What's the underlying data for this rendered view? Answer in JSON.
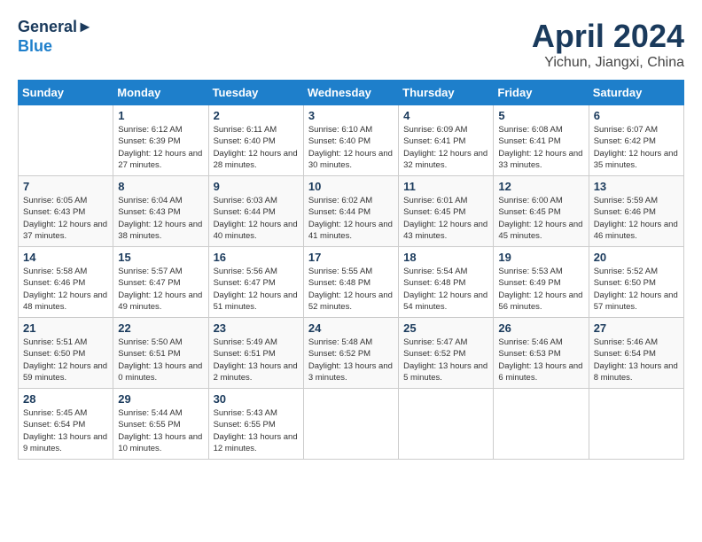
{
  "header": {
    "logo_line1": "General",
    "logo_line2": "Blue",
    "month_title": "April 2024",
    "location": "Yichun, Jiangxi, China"
  },
  "weekdays": [
    "Sunday",
    "Monday",
    "Tuesday",
    "Wednesday",
    "Thursday",
    "Friday",
    "Saturday"
  ],
  "weeks": [
    [
      {
        "num": "",
        "info": ""
      },
      {
        "num": "1",
        "info": "Sunrise: 6:12 AM\nSunset: 6:39 PM\nDaylight: 12 hours\nand 27 minutes."
      },
      {
        "num": "2",
        "info": "Sunrise: 6:11 AM\nSunset: 6:40 PM\nDaylight: 12 hours\nand 28 minutes."
      },
      {
        "num": "3",
        "info": "Sunrise: 6:10 AM\nSunset: 6:40 PM\nDaylight: 12 hours\nand 30 minutes."
      },
      {
        "num": "4",
        "info": "Sunrise: 6:09 AM\nSunset: 6:41 PM\nDaylight: 12 hours\nand 32 minutes."
      },
      {
        "num": "5",
        "info": "Sunrise: 6:08 AM\nSunset: 6:41 PM\nDaylight: 12 hours\nand 33 minutes."
      },
      {
        "num": "6",
        "info": "Sunrise: 6:07 AM\nSunset: 6:42 PM\nDaylight: 12 hours\nand 35 minutes."
      }
    ],
    [
      {
        "num": "7",
        "info": "Sunrise: 6:05 AM\nSunset: 6:43 PM\nDaylight: 12 hours\nand 37 minutes."
      },
      {
        "num": "8",
        "info": "Sunrise: 6:04 AM\nSunset: 6:43 PM\nDaylight: 12 hours\nand 38 minutes."
      },
      {
        "num": "9",
        "info": "Sunrise: 6:03 AM\nSunset: 6:44 PM\nDaylight: 12 hours\nand 40 minutes."
      },
      {
        "num": "10",
        "info": "Sunrise: 6:02 AM\nSunset: 6:44 PM\nDaylight: 12 hours\nand 41 minutes."
      },
      {
        "num": "11",
        "info": "Sunrise: 6:01 AM\nSunset: 6:45 PM\nDaylight: 12 hours\nand 43 minutes."
      },
      {
        "num": "12",
        "info": "Sunrise: 6:00 AM\nSunset: 6:45 PM\nDaylight: 12 hours\nand 45 minutes."
      },
      {
        "num": "13",
        "info": "Sunrise: 5:59 AM\nSunset: 6:46 PM\nDaylight: 12 hours\nand 46 minutes."
      }
    ],
    [
      {
        "num": "14",
        "info": "Sunrise: 5:58 AM\nSunset: 6:46 PM\nDaylight: 12 hours\nand 48 minutes."
      },
      {
        "num": "15",
        "info": "Sunrise: 5:57 AM\nSunset: 6:47 PM\nDaylight: 12 hours\nand 49 minutes."
      },
      {
        "num": "16",
        "info": "Sunrise: 5:56 AM\nSunset: 6:47 PM\nDaylight: 12 hours\nand 51 minutes."
      },
      {
        "num": "17",
        "info": "Sunrise: 5:55 AM\nSunset: 6:48 PM\nDaylight: 12 hours\nand 52 minutes."
      },
      {
        "num": "18",
        "info": "Sunrise: 5:54 AM\nSunset: 6:48 PM\nDaylight: 12 hours\nand 54 minutes."
      },
      {
        "num": "19",
        "info": "Sunrise: 5:53 AM\nSunset: 6:49 PM\nDaylight: 12 hours\nand 56 minutes."
      },
      {
        "num": "20",
        "info": "Sunrise: 5:52 AM\nSunset: 6:50 PM\nDaylight: 12 hours\nand 57 minutes."
      }
    ],
    [
      {
        "num": "21",
        "info": "Sunrise: 5:51 AM\nSunset: 6:50 PM\nDaylight: 12 hours\nand 59 minutes."
      },
      {
        "num": "22",
        "info": "Sunrise: 5:50 AM\nSunset: 6:51 PM\nDaylight: 13 hours\nand 0 minutes."
      },
      {
        "num": "23",
        "info": "Sunrise: 5:49 AM\nSunset: 6:51 PM\nDaylight: 13 hours\nand 2 minutes."
      },
      {
        "num": "24",
        "info": "Sunrise: 5:48 AM\nSunset: 6:52 PM\nDaylight: 13 hours\nand 3 minutes."
      },
      {
        "num": "25",
        "info": "Sunrise: 5:47 AM\nSunset: 6:52 PM\nDaylight: 13 hours\nand 5 minutes."
      },
      {
        "num": "26",
        "info": "Sunrise: 5:46 AM\nSunset: 6:53 PM\nDaylight: 13 hours\nand 6 minutes."
      },
      {
        "num": "27",
        "info": "Sunrise: 5:46 AM\nSunset: 6:54 PM\nDaylight: 13 hours\nand 8 minutes."
      }
    ],
    [
      {
        "num": "28",
        "info": "Sunrise: 5:45 AM\nSunset: 6:54 PM\nDaylight: 13 hours\nand 9 minutes."
      },
      {
        "num": "29",
        "info": "Sunrise: 5:44 AM\nSunset: 6:55 PM\nDaylight: 13 hours\nand 10 minutes."
      },
      {
        "num": "30",
        "info": "Sunrise: 5:43 AM\nSunset: 6:55 PM\nDaylight: 13 hours\nand 12 minutes."
      },
      {
        "num": "",
        "info": ""
      },
      {
        "num": "",
        "info": ""
      },
      {
        "num": "",
        "info": ""
      },
      {
        "num": "",
        "info": ""
      }
    ]
  ]
}
